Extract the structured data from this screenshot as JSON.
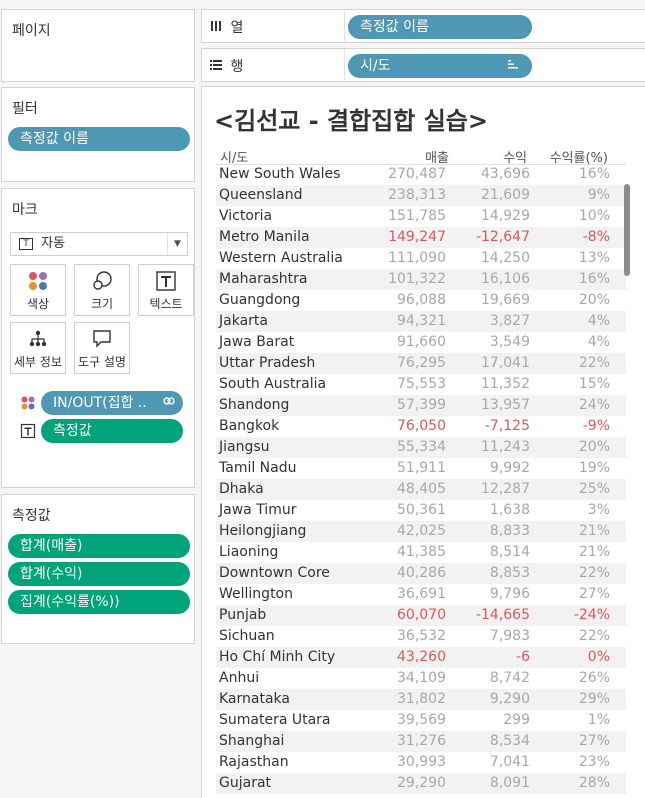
{
  "pages_panel": {
    "title": "페이지"
  },
  "columns_shelf": {
    "label": "열",
    "pill": "측정값 이름"
  },
  "rows_shelf": {
    "label": "행",
    "pill": "시/도"
  },
  "filters_panel": {
    "title": "필터",
    "pill": "측정값 이름"
  },
  "marks_panel": {
    "title": "마크",
    "mark_type": "자동",
    "buttons": {
      "color": "색상",
      "size": "크기",
      "text": "텍스트",
      "detail": "세부 정보",
      "tooltip": "도구 설명"
    },
    "color_field": "IN/OUT(집합 ..",
    "text_field": "측정값"
  },
  "measure_values_panel": {
    "title": "측정값",
    "items": [
      "합계(매출)",
      "합계(수익)",
      "집계(수익률(%))"
    ]
  },
  "view": {
    "title": "<김선교 - 결합집합 실습>",
    "headers": {
      "region": "시/도",
      "sales": "매출",
      "profit": "수익",
      "ratio": "수익률(%)"
    },
    "rows": [
      {
        "name": "New South Wales",
        "sales": "270,487",
        "profit": "43,696",
        "ratio": "16%",
        "neg": false
      },
      {
        "name": "Queensland",
        "sales": "238,313",
        "profit": "21,609",
        "ratio": "9%",
        "neg": false
      },
      {
        "name": "Victoria",
        "sales": "151,785",
        "profit": "14,929",
        "ratio": "10%",
        "neg": false
      },
      {
        "name": "Metro Manila",
        "sales": "149,247",
        "profit": "-12,647",
        "ratio": "-8%",
        "neg": true
      },
      {
        "name": "Western Australia",
        "sales": "111,090",
        "profit": "14,250",
        "ratio": "13%",
        "neg": false
      },
      {
        "name": "Maharashtra",
        "sales": "101,322",
        "profit": "16,106",
        "ratio": "16%",
        "neg": false
      },
      {
        "name": "Guangdong",
        "sales": "96,088",
        "profit": "19,669",
        "ratio": "20%",
        "neg": false
      },
      {
        "name": "Jakarta",
        "sales": "94,321",
        "profit": "3,827",
        "ratio": "4%",
        "neg": false
      },
      {
        "name": "Jawa Barat",
        "sales": "91,660",
        "profit": "3,549",
        "ratio": "4%",
        "neg": false
      },
      {
        "name": "Uttar Pradesh",
        "sales": "76,295",
        "profit": "17,041",
        "ratio": "22%",
        "neg": false
      },
      {
        "name": "South Australia",
        "sales": "75,553",
        "profit": "11,352",
        "ratio": "15%",
        "neg": false
      },
      {
        "name": "Shandong",
        "sales": "57,399",
        "profit": "13,957",
        "ratio": "24%",
        "neg": false
      },
      {
        "name": "Bangkok",
        "sales": "76,050",
        "profit": "-7,125",
        "ratio": "-9%",
        "neg": true
      },
      {
        "name": "Jiangsu",
        "sales": "55,334",
        "profit": "11,243",
        "ratio": "20%",
        "neg": false
      },
      {
        "name": "Tamil Nadu",
        "sales": "51,911",
        "profit": "9,992",
        "ratio": "19%",
        "neg": false
      },
      {
        "name": "Dhaka",
        "sales": "48,405",
        "profit": "12,287",
        "ratio": "25%",
        "neg": false
      },
      {
        "name": "Jawa Timur",
        "sales": "50,361",
        "profit": "1,638",
        "ratio": "3%",
        "neg": false
      },
      {
        "name": "Heilongjiang",
        "sales": "42,025",
        "profit": "8,833",
        "ratio": "21%",
        "neg": false
      },
      {
        "name": "Liaoning",
        "sales": "41,385",
        "profit": "8,514",
        "ratio": "21%",
        "neg": false
      },
      {
        "name": "Downtown Core",
        "sales": "40,286",
        "profit": "8,853",
        "ratio": "22%",
        "neg": false
      },
      {
        "name": "Wellington",
        "sales": "36,691",
        "profit": "9,796",
        "ratio": "27%",
        "neg": false
      },
      {
        "name": "Punjab",
        "sales": "60,070",
        "profit": "-14,665",
        "ratio": "-24%",
        "neg": true
      },
      {
        "name": "Sichuan",
        "sales": "36,532",
        "profit": "7,983",
        "ratio": "22%",
        "neg": false
      },
      {
        "name": "Ho Chí Minh City",
        "sales": "43,260",
        "profit": "-6",
        "ratio": "0%",
        "neg": true
      },
      {
        "name": "Anhui",
        "sales": "34,109",
        "profit": "8,742",
        "ratio": "26%",
        "neg": false
      },
      {
        "name": "Karnataka",
        "sales": "31,802",
        "profit": "9,290",
        "ratio": "29%",
        "neg": false
      },
      {
        "name": "Sumatera Utara",
        "sales": "39,569",
        "profit": "299",
        "ratio": "1%",
        "neg": false
      },
      {
        "name": "Shanghai",
        "sales": "31,276",
        "profit": "8,534",
        "ratio": "27%",
        "neg": false
      },
      {
        "name": "Rajasthan",
        "sales": "30,993",
        "profit": "7,041",
        "ratio": "23%",
        "neg": false
      },
      {
        "name": "Gujarat",
        "sales": "29,290",
        "profit": "8,091",
        "ratio": "28%",
        "neg": false
      }
    ]
  },
  "colors": {
    "dimension_pill": "#4e98b3",
    "measure_pill": "#00a37a",
    "negative": "#e15759",
    "value_text": "#a8a8a8"
  }
}
